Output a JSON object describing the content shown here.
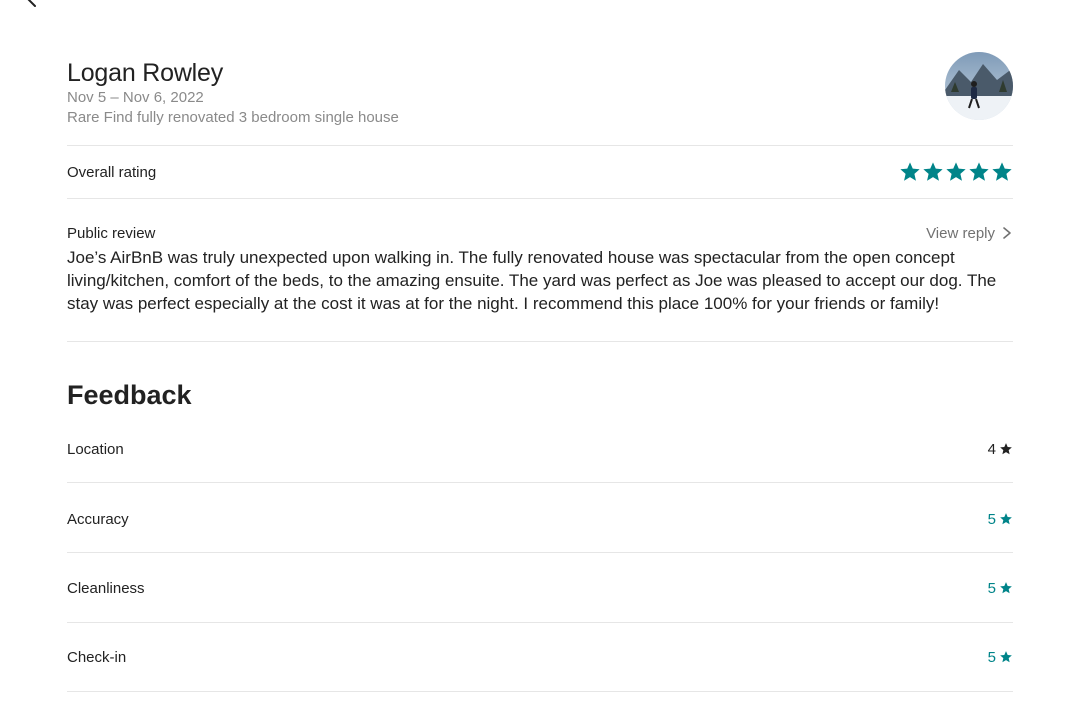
{
  "review": {
    "reviewer_name": "Logan Rowley",
    "dates": "Nov 5 – Nov 6, 2022",
    "listing": "Rare Find fully renovated  3 bedroom single house",
    "overall_label": "Overall rating",
    "overall_stars": 5,
    "public_review_label": "Public review",
    "view_reply_label": "View reply",
    "text": "Joe’s AirBnB was truly unexpected upon walking in. The fully renovated house was spectacular from the open concept living/kitchen, comfort of the beds, to the amazing ensuite. The yard was perfect as Joe was pleased to accept our dog. The stay was perfect especially at the cost it was at for the night. I recommend this place 100% for your friends or family!"
  },
  "feedback": {
    "title": "Feedback",
    "items": [
      {
        "label": "Location",
        "value": "4"
      },
      {
        "label": "Accuracy",
        "value": "5"
      },
      {
        "label": "Cleanliness",
        "value": "5"
      },
      {
        "label": "Check-in",
        "value": "5"
      }
    ]
  },
  "colors": {
    "accent": "#008489",
    "dark_star": "#222222",
    "divider": "#e6e6e6"
  },
  "icons": {
    "back": "chevron-left-icon",
    "star": "star-icon",
    "view_reply": "chevron-right-icon"
  }
}
